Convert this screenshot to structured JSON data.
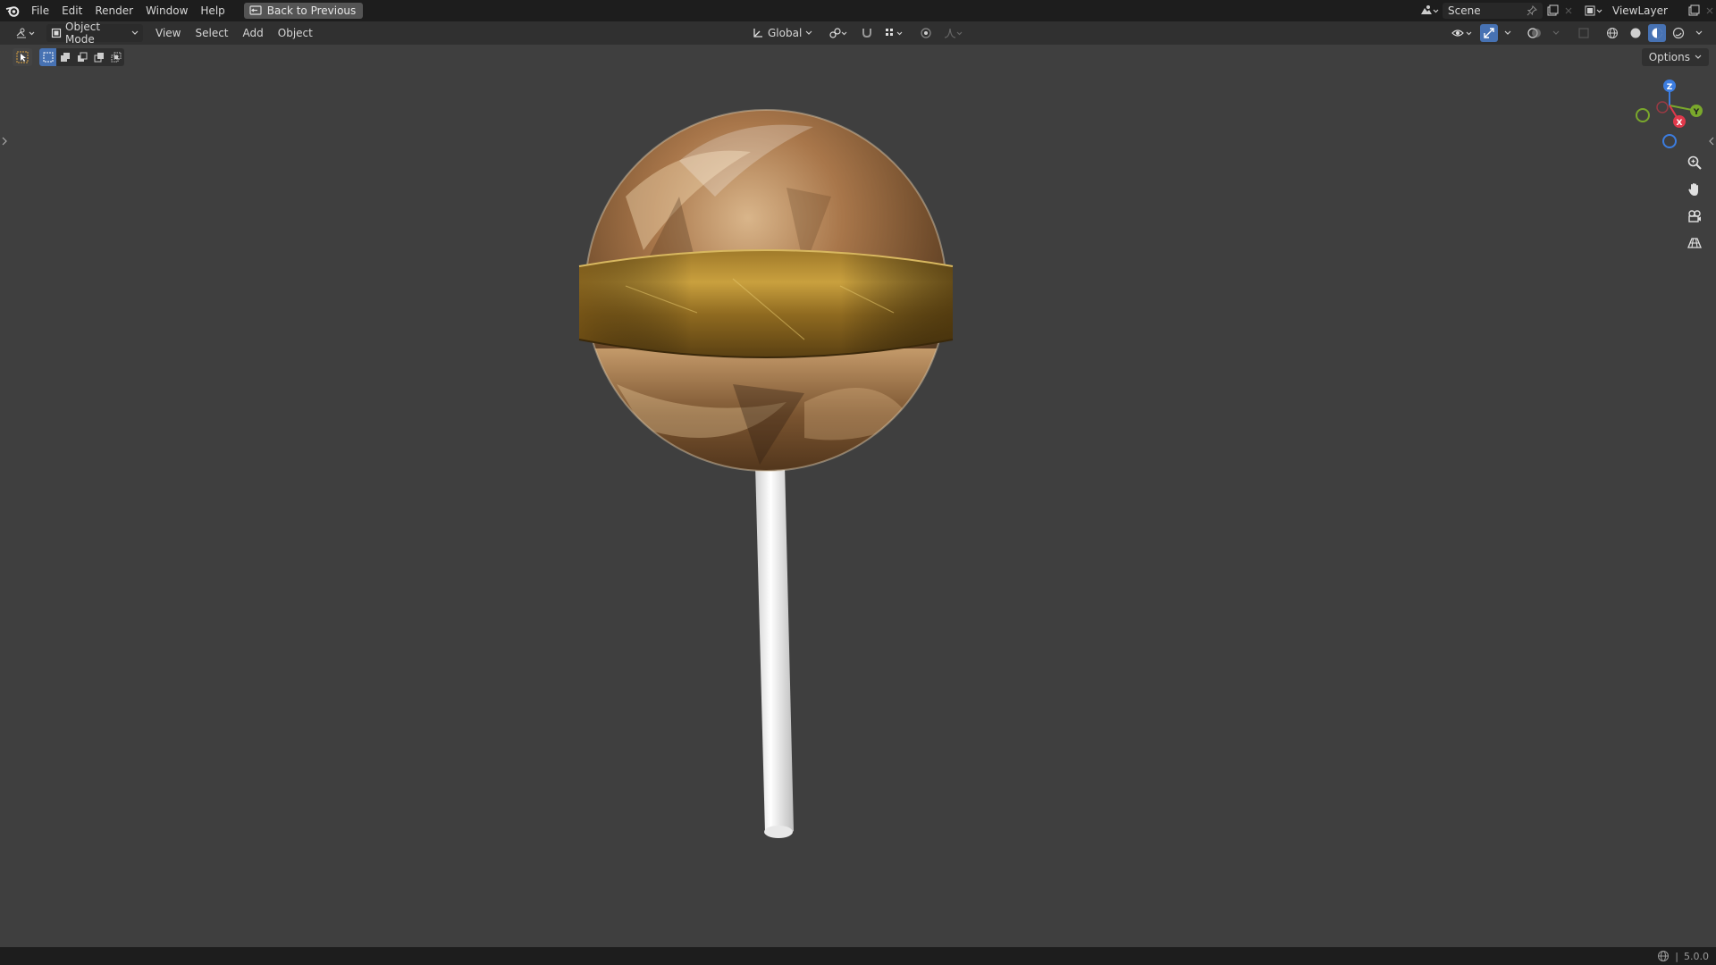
{
  "menu": {
    "items": [
      "File",
      "Edit",
      "Render",
      "Window",
      "Help"
    ],
    "back_button": "Back to Previous"
  },
  "top_right": {
    "scene": "Scene",
    "view_layer": "ViewLayer"
  },
  "viewport_header": {
    "mode": "Object Mode",
    "menus": [
      "View",
      "Select",
      "Add",
      "Object"
    ],
    "transform_orientation": "Global"
  },
  "tool_settings": {
    "options_label": "Options"
  },
  "gizmo": {
    "z_label": "Z",
    "y_label": "Y",
    "x_label": "X",
    "colors": {
      "x": "#e0394b",
      "y": "#7aa82c",
      "z": "#3c7de0"
    }
  },
  "status": {
    "version": "5.0.0"
  },
  "colors": {
    "accent": "#4772b3",
    "background": "#3f3f3f"
  }
}
